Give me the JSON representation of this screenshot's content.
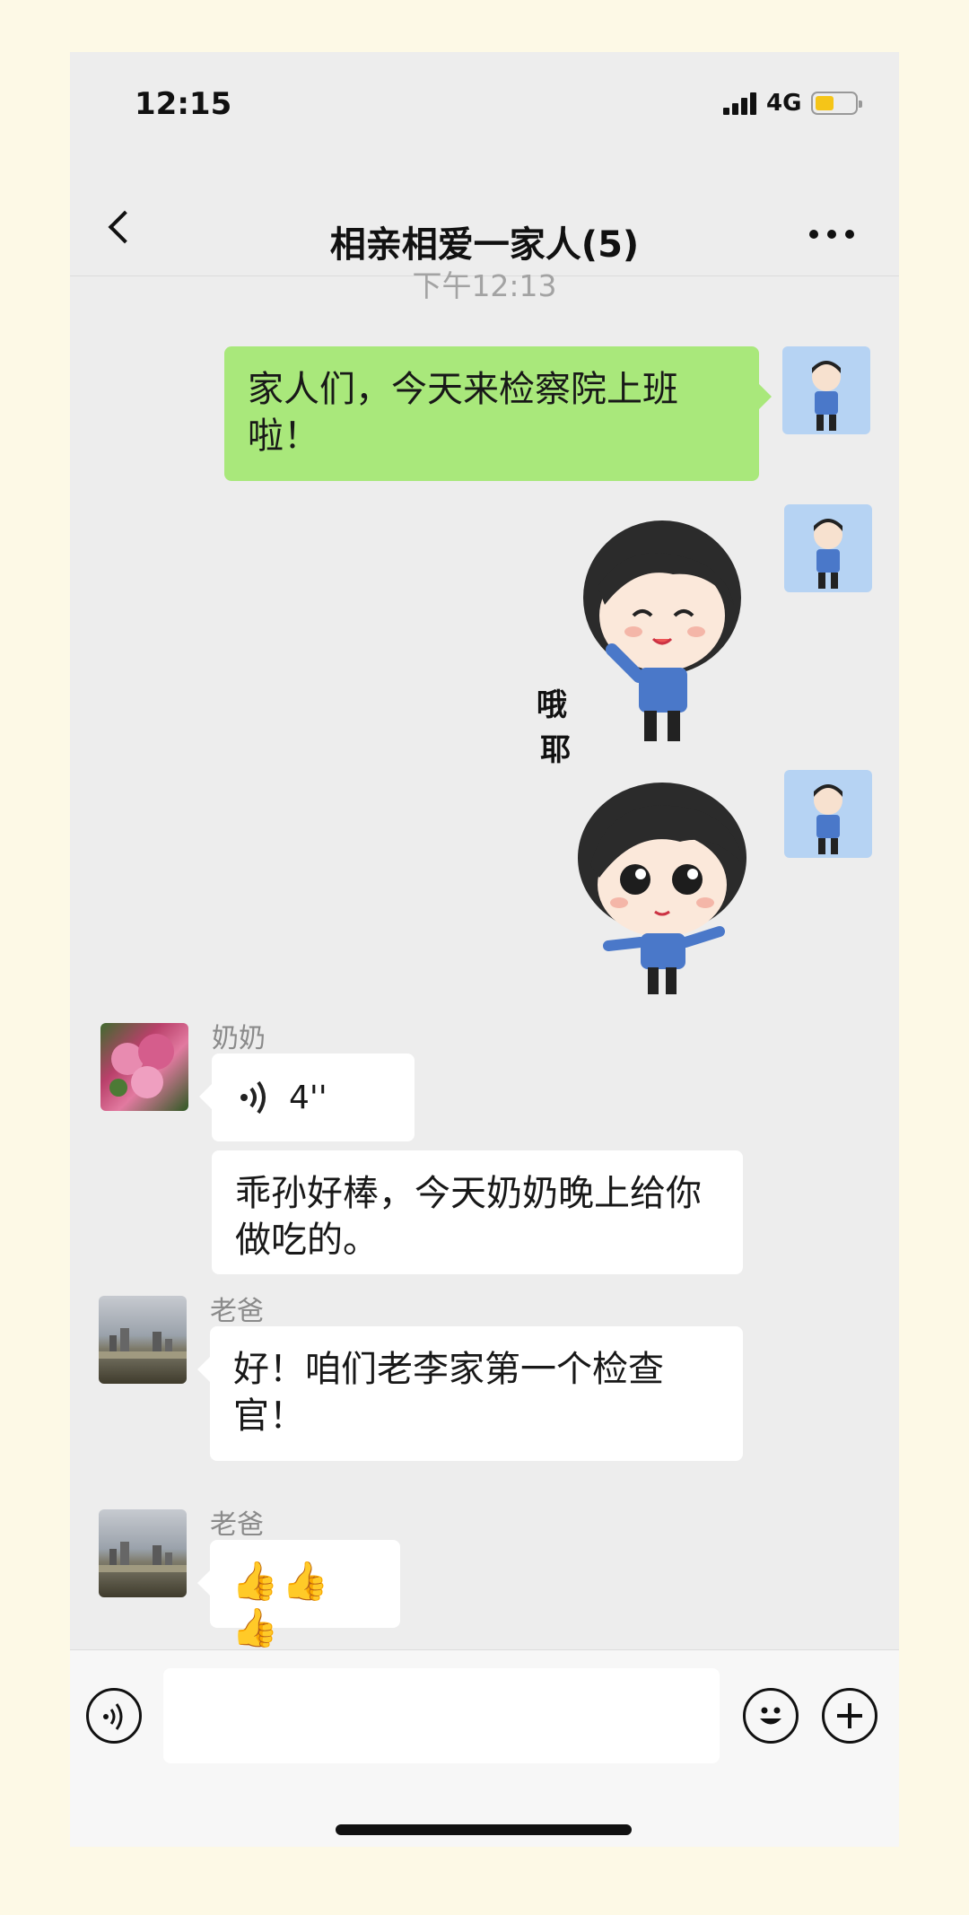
{
  "status_bar": {
    "time": "12:15",
    "network": "4G",
    "battery_level": 0.4
  },
  "nav": {
    "title": "相亲相爱一家人(5)",
    "icons": [
      "back-icon",
      "more-icon"
    ]
  },
  "chat": {
    "timestamp": "下午12:13",
    "messages": [
      {
        "from": "self",
        "type": "text",
        "text": "家人们，今天来检察院上班啦！"
      },
      {
        "from": "self",
        "type": "sticker",
        "sticker_text": [
          "哦",
          "耶"
        ]
      },
      {
        "from": "self",
        "type": "sticker"
      },
      {
        "from": "奶奶",
        "type": "voice",
        "duration": "4''"
      },
      {
        "from": "奶奶",
        "type": "text",
        "text": "乖孙好棒，今天奶奶晚上给你做吃的。"
      },
      {
        "from": "老爸",
        "type": "text",
        "text": "好！咱们老李家第一个检查官！"
      },
      {
        "from": "老爸",
        "type": "text",
        "text": "👍👍👍"
      }
    ]
  },
  "input_bar": {
    "icons": [
      "voice-icon",
      "emoji-icon",
      "plus-icon"
    ],
    "value": ""
  }
}
